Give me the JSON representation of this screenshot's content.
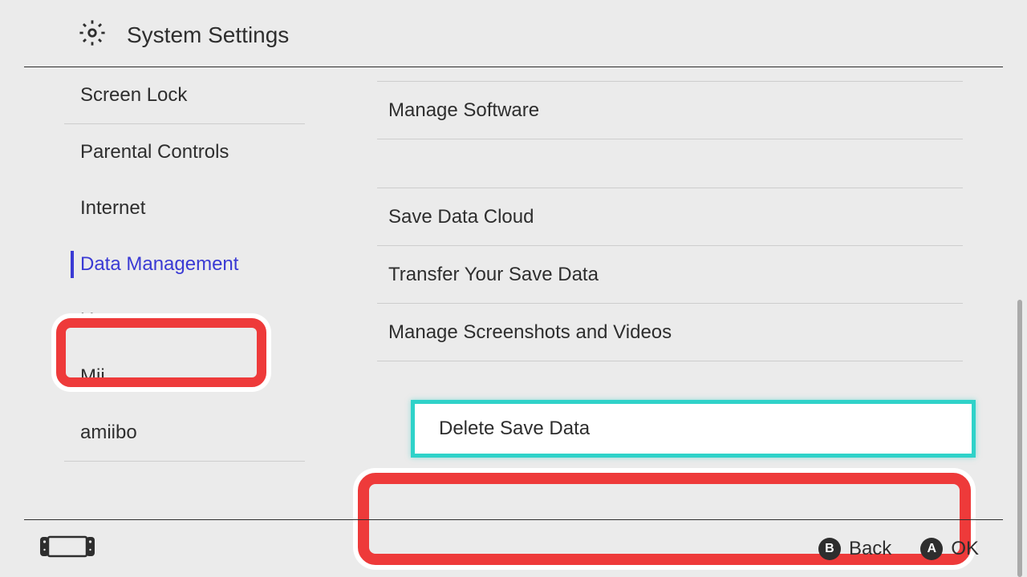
{
  "header": {
    "title": "System Settings"
  },
  "sidebar": {
    "items": [
      {
        "label": "Screen Lock",
        "selected": false
      },
      {
        "label": "Parental Controls",
        "selected": false
      },
      {
        "label": "Internet",
        "selected": false
      },
      {
        "label": "Data Management",
        "selected": true
      },
      {
        "label": "Users",
        "selected": false
      },
      {
        "label": "Mii",
        "selected": false
      },
      {
        "label": "amiibo",
        "selected": false
      }
    ]
  },
  "main": {
    "items": [
      {
        "label": "Manage Software",
        "selected": false
      },
      {
        "label": "Save Data Cloud",
        "selected": false
      },
      {
        "label": "Transfer Your Save Data",
        "selected": false
      },
      {
        "label": "Manage Screenshots and Videos",
        "selected": false
      },
      {
        "label": "Delete Save Data",
        "selected": true
      }
    ]
  },
  "footer": {
    "buttons": [
      {
        "glyph": "B",
        "label": "Back"
      },
      {
        "glyph": "A",
        "label": "OK"
      }
    ]
  },
  "highlights": {
    "sidebar_highlight": "Data Management",
    "main_highlight": "Delete Save Data"
  }
}
